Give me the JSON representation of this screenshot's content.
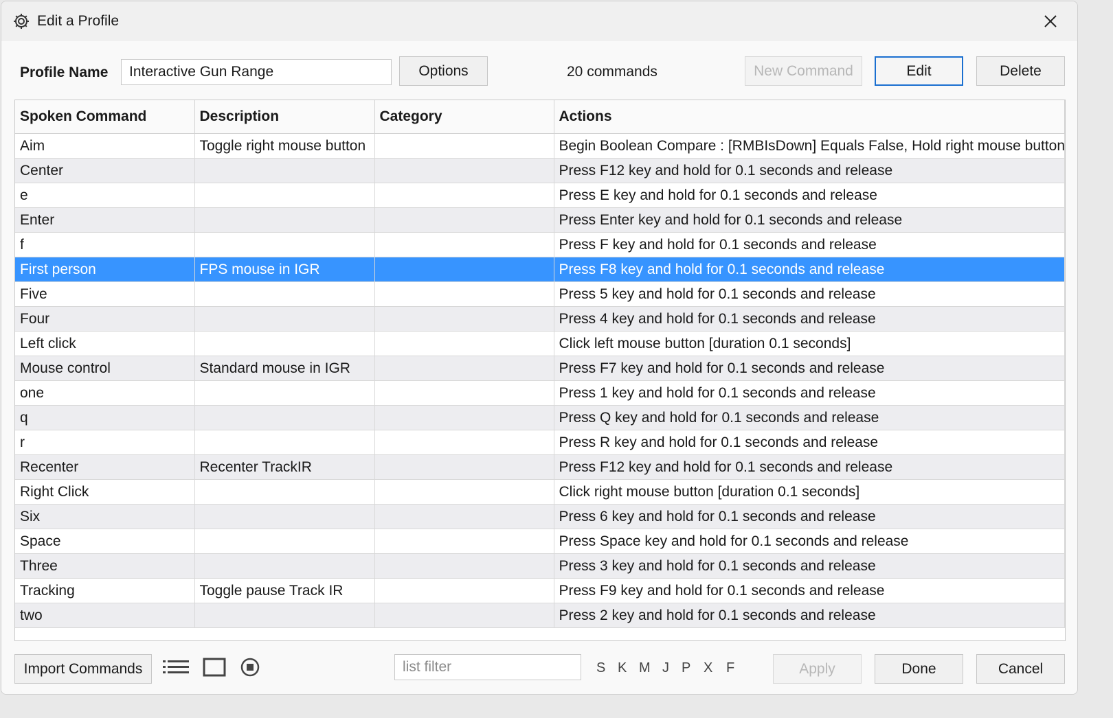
{
  "window": {
    "title": "Edit a Profile",
    "icon": "gear-icon",
    "close_icon": "close-icon"
  },
  "profile": {
    "label": "Profile Name",
    "name": "Interactive Gun Range",
    "options_label": "Options",
    "command_count": "20 commands"
  },
  "toolbar": {
    "new_command": "New Command",
    "edit": "Edit",
    "delete": "Delete"
  },
  "table": {
    "columns": [
      "Spoken Command",
      "Description",
      "Category",
      "Actions"
    ],
    "selected_index": 5,
    "rows": [
      {
        "command": "Aim",
        "description": "Toggle right mouse button",
        "category": "",
        "actions": "Begin Boolean Compare : [RMBIsDown] Equals False, Hold right mouse button dow"
      },
      {
        "command": "Center",
        "description": "",
        "category": "",
        "actions": "Press F12 key and hold for 0.1 seconds and release"
      },
      {
        "command": "e",
        "description": "",
        "category": "",
        "actions": "Press E key and hold for 0.1 seconds and release"
      },
      {
        "command": "Enter",
        "description": "",
        "category": "",
        "actions": "Press Enter key and hold for 0.1 seconds and release"
      },
      {
        "command": "f",
        "description": "",
        "category": "",
        "actions": "Press F key and hold for 0.1 seconds and release"
      },
      {
        "command": "First person",
        "description": "FPS mouse in IGR",
        "category": "",
        "actions": "Press F8 key and hold for 0.1 seconds and release"
      },
      {
        "command": "Five",
        "description": "",
        "category": "",
        "actions": "Press 5 key and hold for 0.1 seconds and release"
      },
      {
        "command": "Four",
        "description": "",
        "category": "",
        "actions": "Press 4 key and hold for 0.1 seconds and release"
      },
      {
        "command": "Left click",
        "description": "",
        "category": "",
        "actions": "Click left mouse button [duration 0.1 seconds]"
      },
      {
        "command": "Mouse control",
        "description": "Standard mouse in IGR",
        "category": "",
        "actions": "Press F7 key and hold for 0.1 seconds and release"
      },
      {
        "command": "one",
        "description": "",
        "category": "",
        "actions": "Press 1 key and hold for 0.1 seconds and release"
      },
      {
        "command": "q",
        "description": "",
        "category": "",
        "actions": "Press Q key and hold for 0.1 seconds and release"
      },
      {
        "command": "r",
        "description": "",
        "category": "",
        "actions": "Press R key and hold for 0.1 seconds and release"
      },
      {
        "command": "Recenter",
        "description": "Recenter TrackIR",
        "category": "",
        "actions": "Press F12 key and hold for 0.1 seconds and release"
      },
      {
        "command": "Right Click",
        "description": "",
        "category": "",
        "actions": "Click right mouse button [duration 0.1 seconds]"
      },
      {
        "command": "Six",
        "description": "",
        "category": "",
        "actions": "Press 6 key and hold for 0.1 seconds and release"
      },
      {
        "command": "Space",
        "description": "",
        "category": "",
        "actions": "Press Space key and hold for 0.1 seconds and release"
      },
      {
        "command": "Three",
        "description": "",
        "category": "",
        "actions": "Press 3 key and hold for 0.1 seconds and release"
      },
      {
        "command": "Tracking",
        "description": "Toggle pause Track IR",
        "category": "",
        "actions": "Press F9 key and hold for 0.1 seconds and release"
      },
      {
        "command": "two",
        "description": "",
        "category": "",
        "actions": "Press 2 key and hold for 0.1 seconds and release"
      }
    ]
  },
  "bottom": {
    "import_label": "Import Commands",
    "view_icons": [
      "list-view-icon",
      "window-view-icon",
      "stop-icon"
    ],
    "filter_placeholder": "list filter",
    "filter_value": "",
    "filter_letters": [
      "S",
      "K",
      "M",
      "J",
      "P",
      "X",
      "F"
    ],
    "apply": "Apply",
    "done": "Done",
    "cancel": "Cancel"
  },
  "colors": {
    "selection": "#3794ff",
    "focus_border": "#1a6fd0",
    "alt_row": "#ededf0"
  }
}
